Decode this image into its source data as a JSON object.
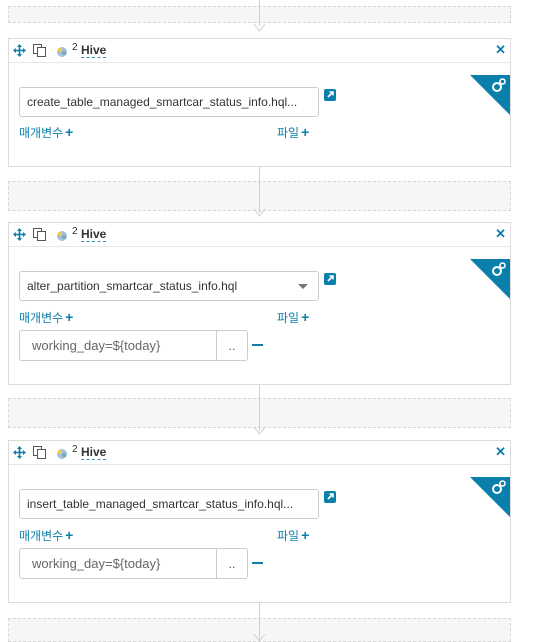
{
  "nodes": [
    {
      "type_label": "Hive",
      "badge": "2",
      "file": "create_table_managed_smartcar_status_info.hql...",
      "params_label": "매개변수",
      "files_label": "파일",
      "params": []
    },
    {
      "type_label": "Hive",
      "badge": "2",
      "file": "alter_partition_smartcar_status_info.hql",
      "params_label": "매개변수",
      "files_label": "파일",
      "params": [
        {
          "value": "working_day=${today}",
          "browse": ".."
        }
      ]
    },
    {
      "type_label": "Hive",
      "badge": "2",
      "file": "insert_table_managed_smartcar_status_info.hql...",
      "params_label": "매개변수",
      "files_label": "파일",
      "params": [
        {
          "value": "working_day=${today}",
          "browse": ".."
        }
      ]
    }
  ],
  "icons": {
    "move": "move-icon",
    "copy": "copy-icon",
    "hive": "hive-icon",
    "close": "close-icon",
    "settings": "gears-icon",
    "external": "external-link-icon"
  },
  "colors": {
    "accent": "#0b7fab",
    "border": "#dcdcdc",
    "dropzone": "#f6f6f6"
  }
}
